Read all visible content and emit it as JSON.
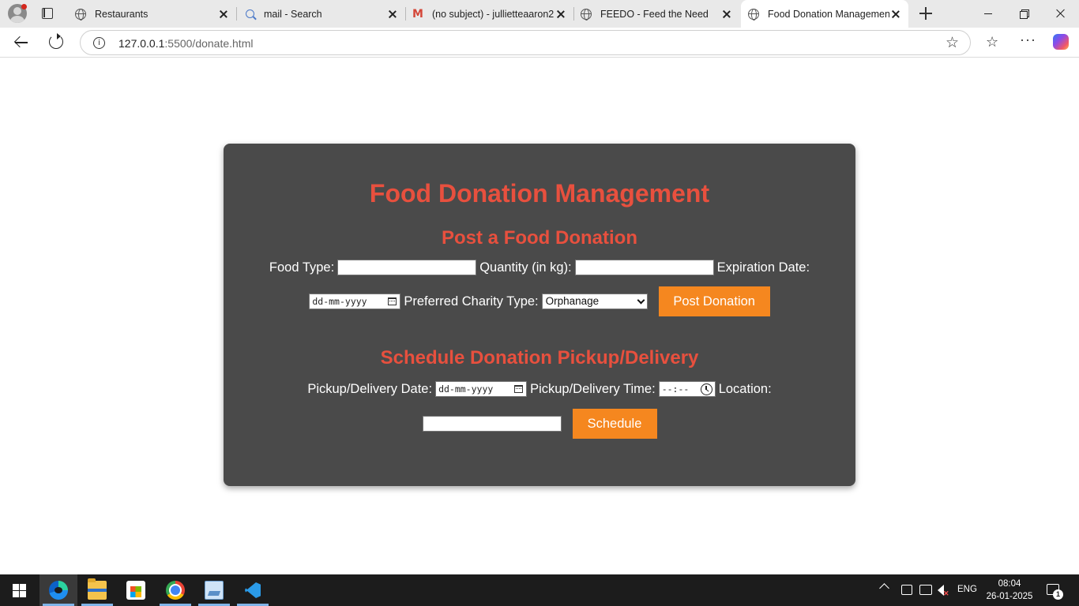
{
  "browser": {
    "tabs": [
      {
        "title": "Restaurants",
        "icon": "globe-icon"
      },
      {
        "title": "mail - Search",
        "icon": "search-icon"
      },
      {
        "title": "(no subject) - jullietteaaron2",
        "icon": "gmail-icon"
      },
      {
        "title": "FEEDO - Feed the Need",
        "icon": "globe-icon"
      },
      {
        "title": "Food Donation Management",
        "icon": "globe-icon"
      }
    ],
    "active_tab_index": 4,
    "url_host": "127.0.0.1",
    "url_path": ":5500/donate.html"
  },
  "page": {
    "title": "Food Donation Management",
    "post_section": {
      "heading": "Post a Food Donation",
      "food_type_label": "Food Type:",
      "food_type_value": "",
      "quantity_label": "Quantity (in kg):",
      "quantity_value": "",
      "expiration_label": "Expiration Date:",
      "expiration_placeholder": "dd-mm-yyyy",
      "charity_label": "Preferred Charity Type:",
      "charity_selected": "Orphanage",
      "submit_label": "Post Donation"
    },
    "schedule_section": {
      "heading": "Schedule Donation Pickup/Delivery",
      "date_label": "Pickup/Delivery Date:",
      "date_placeholder": "dd-mm-yyyy",
      "time_label": "Pickup/Delivery Time:",
      "time_placeholder": "--:--",
      "location_label": "Location:",
      "location_value": "",
      "submit_label": "Schedule"
    },
    "colors": {
      "card_background": "#4a4a4a",
      "heading": "#e8503e",
      "button": "#f5871f"
    }
  },
  "taskbar": {
    "apps": [
      "edge-icon",
      "file-explorer-icon",
      "store-icon",
      "chrome-icon",
      "paint-icon",
      "vscode-icon"
    ],
    "language": "ENG",
    "time": "08:04",
    "date": "26-01-2025",
    "notification_count": "1"
  }
}
